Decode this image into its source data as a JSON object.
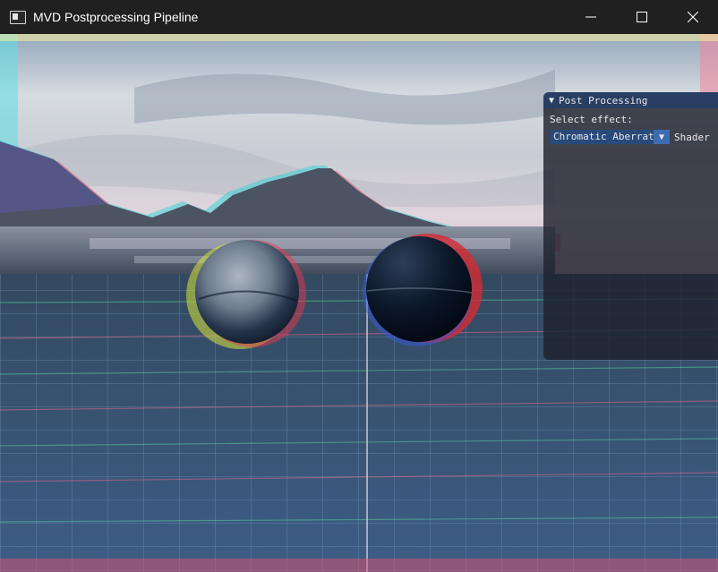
{
  "window": {
    "title": "MVD Postprocessing Pipeline"
  },
  "icons": {
    "app": "app-window-icon",
    "minimize": "minimize-icon",
    "maximize": "maximize-icon",
    "close": "close-icon",
    "collapse": "collapse-triangle-icon",
    "dropdown": "dropdown-arrow-icon"
  },
  "panel": {
    "title": "Post Processing",
    "select_label": "Select effect:",
    "combo_value": "Chromatic Aberration",
    "combo_label": "Shader"
  },
  "colors": {
    "titlebar": "#202020",
    "panel_title": "#293e63",
    "combo_bg": "#284a7a",
    "combo_button": "#3d6bb0"
  }
}
